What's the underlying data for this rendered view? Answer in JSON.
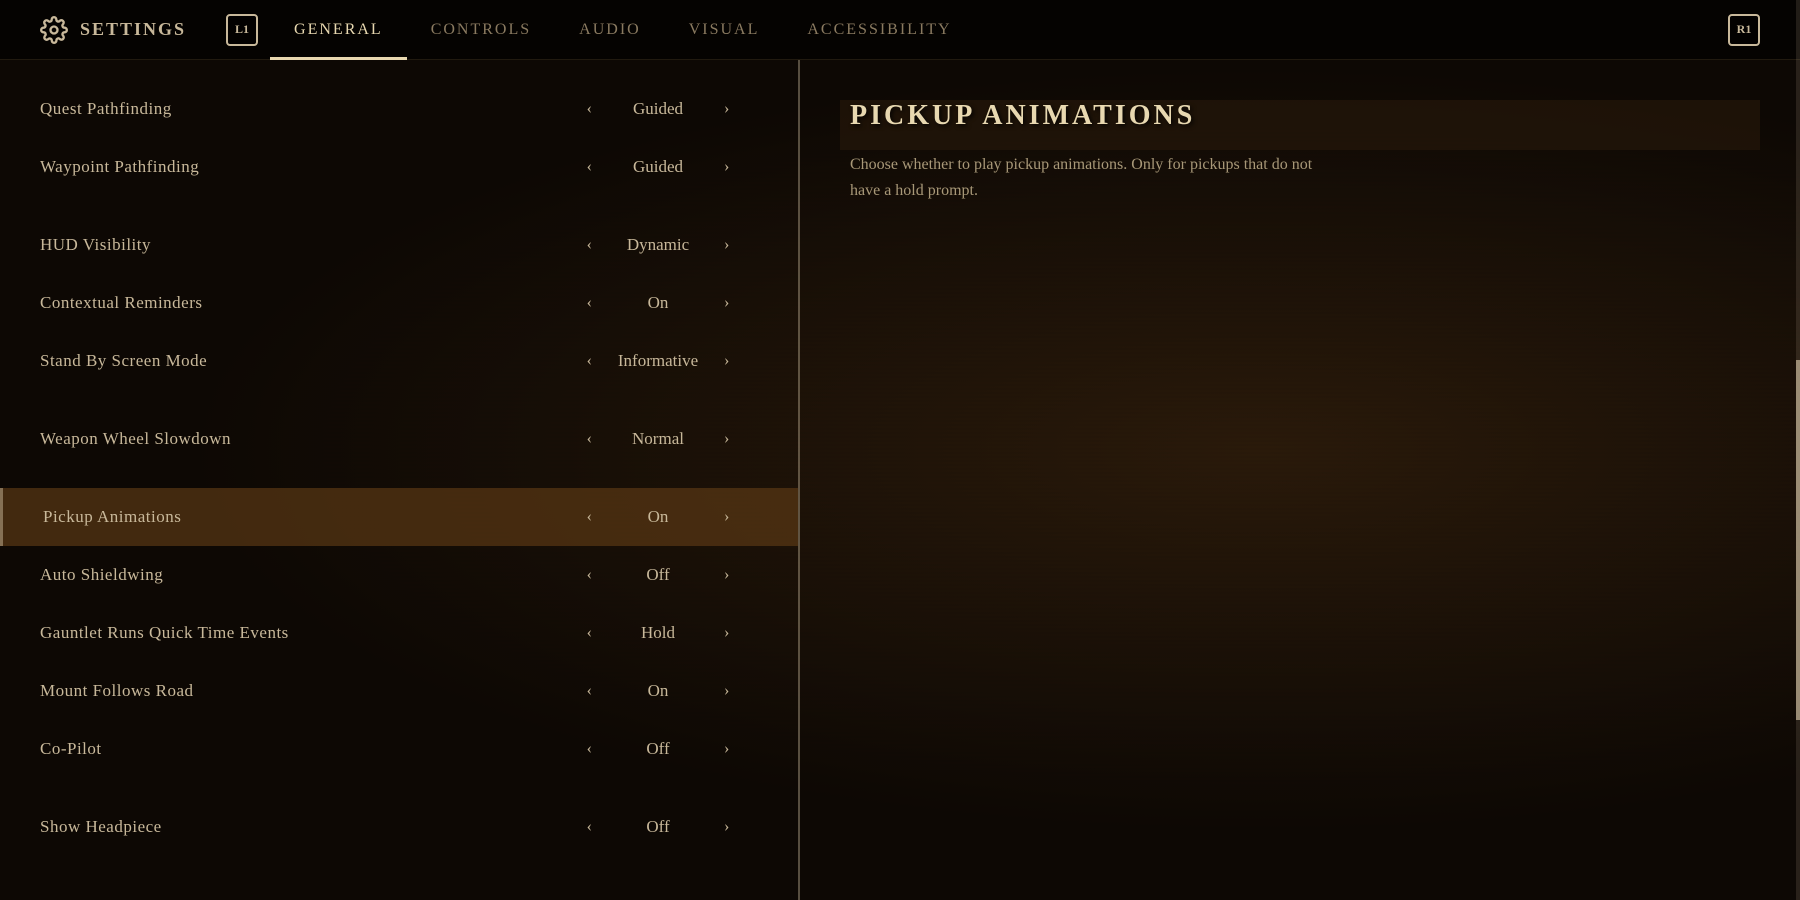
{
  "nav": {
    "settings_label": "SETTINGS",
    "btn_l1": "L1",
    "btn_r1": "R1",
    "tabs": [
      {
        "id": "general",
        "label": "GENERAL",
        "active": true
      },
      {
        "id": "controls",
        "label": "CONTROLS",
        "active": false
      },
      {
        "id": "audio",
        "label": "AUDIO",
        "active": false
      },
      {
        "id": "visual",
        "label": "VISUAL",
        "active": false
      },
      {
        "id": "accessibility",
        "label": "ACCESSIBILITY",
        "active": false
      }
    ]
  },
  "settings": [
    {
      "id": "quest-pathfinding",
      "name": "Quest Pathfinding",
      "value": "Guided",
      "active": false
    },
    {
      "id": "waypoint-pathfinding",
      "name": "Waypoint Pathfinding",
      "value": "Guided",
      "active": false
    },
    {
      "id": "spacer1",
      "spacer": true
    },
    {
      "id": "hud-visibility",
      "name": "HUD Visibility",
      "value": "Dynamic",
      "active": false
    },
    {
      "id": "contextual-reminders",
      "name": "Contextual Reminders",
      "value": "On",
      "active": false
    },
    {
      "id": "standby-screen-mode",
      "name": "Stand By Screen Mode",
      "value": "Informative",
      "active": false
    },
    {
      "id": "spacer2",
      "spacer": true
    },
    {
      "id": "weapon-wheel-slowdown",
      "name": "Weapon Wheel Slowdown",
      "value": "Normal",
      "active": false
    },
    {
      "id": "spacer3",
      "spacer": true
    },
    {
      "id": "pickup-animations",
      "name": "Pickup Animations",
      "value": "On",
      "active": true
    },
    {
      "id": "auto-shieldwing",
      "name": "Auto Shieldwing",
      "value": "Off",
      "active": false
    },
    {
      "id": "gauntlet-runs",
      "name": "Gauntlet Runs Quick Time Events",
      "value": "Hold",
      "active": false
    },
    {
      "id": "mount-follows-road",
      "name": "Mount Follows Road",
      "value": "On",
      "active": false
    },
    {
      "id": "co-pilot",
      "name": "Co-Pilot",
      "value": "Off",
      "active": false
    },
    {
      "id": "spacer4",
      "spacer": true
    },
    {
      "id": "show-headpiece",
      "name": "Show Headpiece",
      "value": "Off",
      "active": false
    }
  ],
  "detail": {
    "title": "PICKUP ANIMATIONS",
    "description": "Choose whether to play pickup animations. Only for pickups that do not have a hold prompt."
  }
}
